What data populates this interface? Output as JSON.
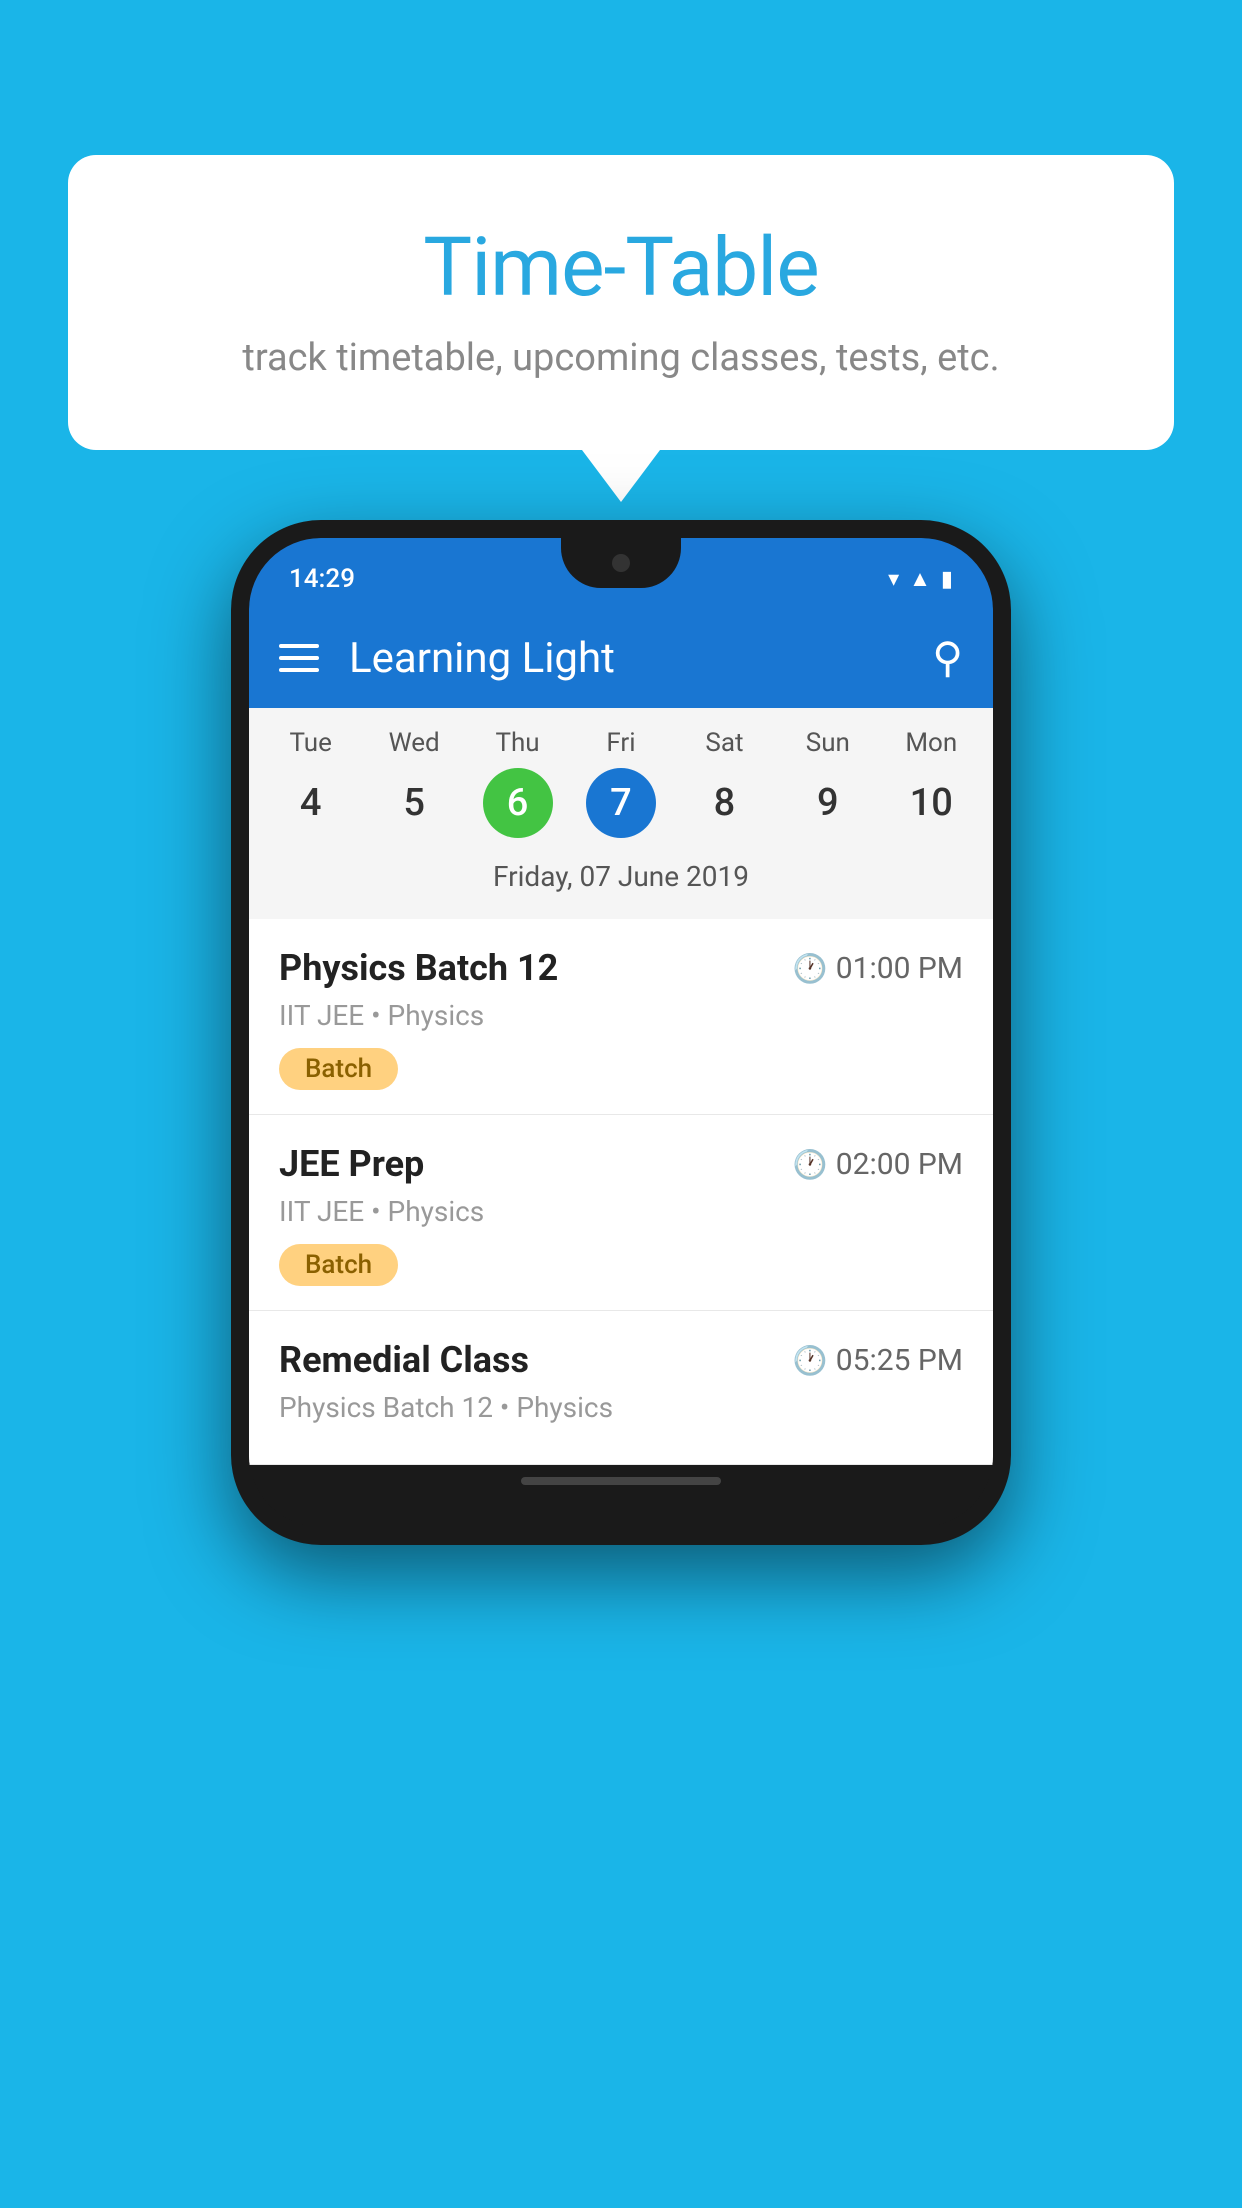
{
  "background_color": "#1ab5e8",
  "speech_bubble": {
    "title": "Time-Table",
    "subtitle": "track timetable, upcoming classes, tests, etc."
  },
  "phone": {
    "status_bar": {
      "time": "14:29",
      "icons": [
        "wifi",
        "signal",
        "battery"
      ]
    },
    "app_bar": {
      "title": "Learning Light",
      "menu_icon": "hamburger",
      "search_icon": "search"
    },
    "calendar": {
      "days": [
        {
          "label": "Tue",
          "num": "4"
        },
        {
          "label": "Wed",
          "num": "5"
        },
        {
          "label": "Thu",
          "num": "6",
          "state": "today"
        },
        {
          "label": "Fri",
          "num": "7",
          "state": "selected"
        },
        {
          "label": "Sat",
          "num": "8"
        },
        {
          "label": "Sun",
          "num": "9"
        },
        {
          "label": "Mon",
          "num": "10"
        }
      ],
      "date_label": "Friday, 07 June 2019"
    },
    "schedule": [
      {
        "title": "Physics Batch 12",
        "time": "01:00 PM",
        "meta": "IIT JEE • Physics",
        "badge": "Batch"
      },
      {
        "title": "JEE Prep",
        "time": "02:00 PM",
        "meta": "IIT JEE • Physics",
        "badge": "Batch"
      },
      {
        "title": "Remedial Class",
        "time": "05:25 PM",
        "meta": "Physics Batch 12 • Physics",
        "badge": null
      }
    ]
  }
}
